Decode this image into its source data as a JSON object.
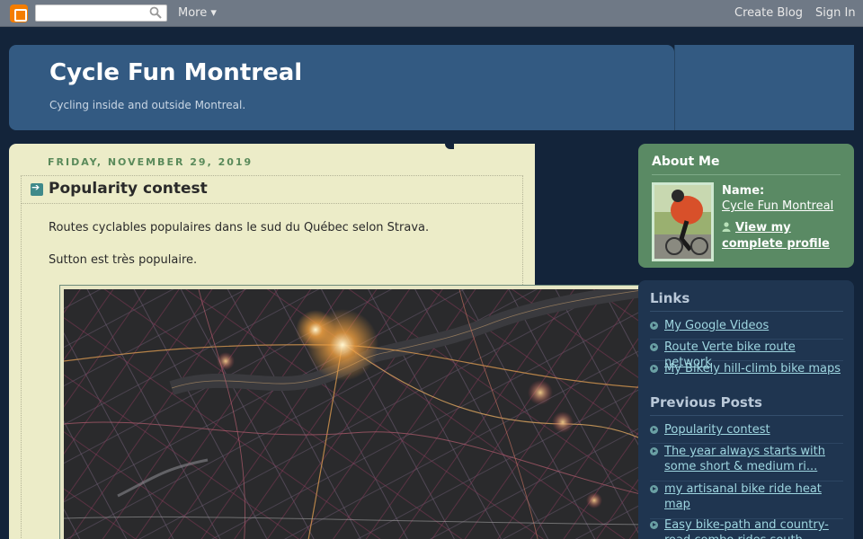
{
  "navbar": {
    "search_placeholder": "",
    "more_label": "More ▾",
    "create_blog_label": "Create Blog",
    "sign_in_label": "Sign In"
  },
  "header": {
    "title": "Cycle Fun Montreal",
    "description": "Cycling inside and outside Montreal."
  },
  "post": {
    "date": "FRIDAY, NOVEMBER 29, 2019",
    "title": "Popularity contest",
    "paragraphs": [
      "Routes cyclables populaires dans le sud du Québec selon Strava.",
      "Sutton est très populaire."
    ]
  },
  "about": {
    "title": "About Me",
    "name_label": "Name:",
    "name": "Cycle Fun Montreal",
    "profile_link": "View my complete profile"
  },
  "links": {
    "title": "Links",
    "items": [
      "My Google Videos",
      "Route Verte bike route network",
      "My Bikely hill-climb bike maps"
    ]
  },
  "previous_posts": {
    "title": "Previous Posts",
    "items": [
      "Popularity contest",
      "The year always starts with some short & medium ri...",
      "my artisanal bike ride heat map",
      "Easy bike-path and country-road combo rides south..."
    ]
  },
  "colors": {
    "background": "#13243a",
    "header": "#335a82",
    "post_bg": "#ececc8",
    "about_bg": "#5a8a64",
    "link_color": "#9ed6e0"
  }
}
